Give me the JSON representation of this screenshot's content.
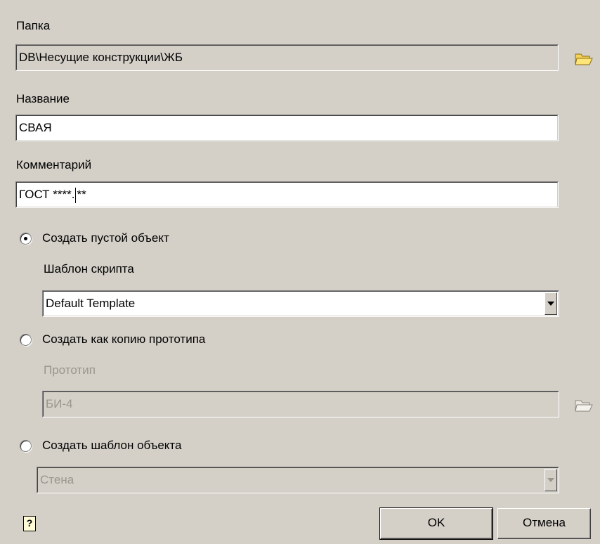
{
  "folder": {
    "label": "Папка",
    "value": "DB\\Несущие конструкции\\ЖБ"
  },
  "name": {
    "label": "Название",
    "value": "СВАЯ"
  },
  "comment": {
    "label": "Комментарий",
    "value_before_caret": "ГОСТ ****.",
    "value_after_caret": "**"
  },
  "option_empty": {
    "label": "Создать пустой объект",
    "selected": true,
    "script_template_label": "Шаблон скрипта",
    "script_template_value": "Default Template"
  },
  "option_copy": {
    "label": "Создать как копию прототипа",
    "selected": false,
    "prototype_label": "Прототип",
    "prototype_value": "БИ-4"
  },
  "option_template": {
    "label": "Создать шаблон объекта",
    "selected": false,
    "template_value": "Стена"
  },
  "buttons": {
    "ok": "OK",
    "cancel": "Отмена",
    "help": "?"
  },
  "icons": {
    "folder": "folder-open-icon",
    "folder_disabled": "folder-open-icon",
    "help": "help-icon"
  },
  "colors": {
    "dialog_bg": "#d4d0c8",
    "folder_yellow": "#f5d25a",
    "disabled_text": "#9a968e"
  }
}
